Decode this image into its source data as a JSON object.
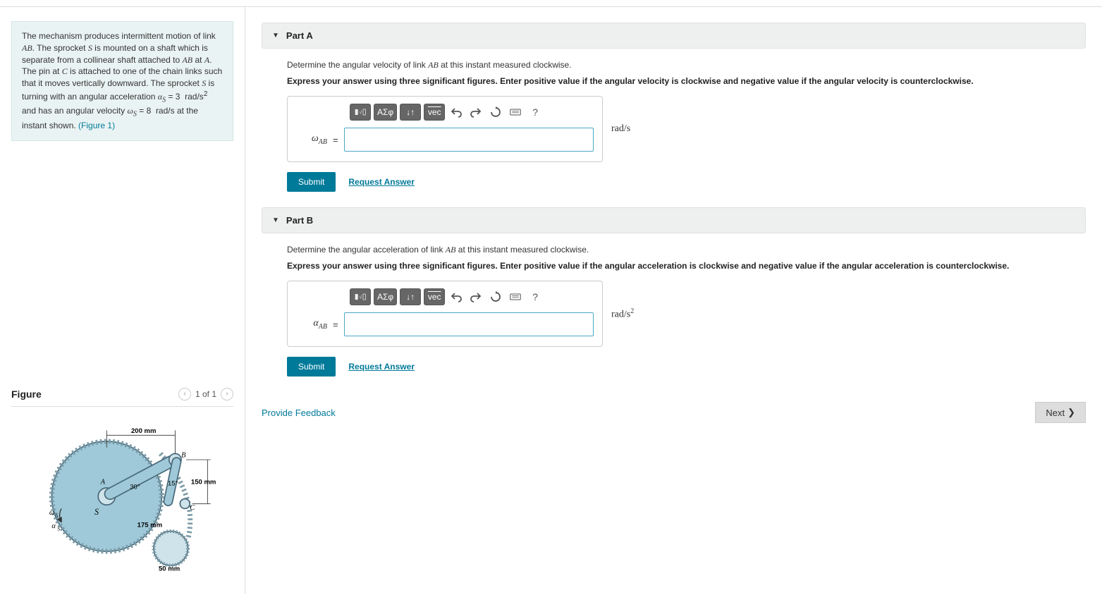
{
  "problem": {
    "text_html": "The mechanism produces intermittent motion of link <span class='mathit'>AB</span>. The sprocket <span class='mathit'>S</span> is mounted on a shaft which is separate from a collinear shaft attached to <span class='mathit'>AB</span> at <span class='mathit'>A</span>. The pin at <span class='mathit'>C</span> is attached to one of the chain links such that it moves vertically downward. The sprocket <span class='mathit'>S</span> is turning with an angular acceleration <span class='mathit'>α<sub>S</sub></span> = 3&nbsp; rad/s<sup>2</sup> and has an angular velocity <span class='mathit'>ω<sub>S</sub></span> = 8&nbsp; rad/s at the instant shown. ",
    "figure_link": "(Figure 1)"
  },
  "figure_panel": {
    "title": "Figure",
    "counter": "1 of 1",
    "dims": {
      "d1": "200 mm",
      "d2": "150 mm",
      "d3": "175 mm",
      "d4": "50 mm",
      "ang1": "30°",
      "ang2": "15°"
    },
    "labels": {
      "A": "A",
      "B": "B",
      "C": "C",
      "S": "S",
      "wS": "ωS",
      "aS": "αS"
    }
  },
  "parts": [
    {
      "title": "Part A",
      "question_html": "Determine the angular velocity of link <span class='mathit'>AB</span> at this instant measured clockwise.",
      "instruction": "Express your answer using three significant figures. Enter positive value if the angular velocity is clockwise and negative value if the angular velocity is counterclockwise.",
      "var_label_html": "ω<sub>AB</sub>",
      "unit_html": "rad/s",
      "value": "",
      "submit": "Submit",
      "request": "Request Answer"
    },
    {
      "title": "Part B",
      "question_html": "Determine the angular acceleration of link <span class='mathit'>AB</span> at this instant measured clockwise.",
      "instruction": "Express your answer using three significant figures. Enter positive value if the angular acceleration is clockwise and negative value if the angular acceleration is counterclockwise.",
      "var_label_html": "α<sub>AB</sub>",
      "unit_html": "rad/s<sup>2</sup>",
      "value": "",
      "submit": "Submit",
      "request": "Request Answer"
    }
  ],
  "toolbar": {
    "templates": "templates",
    "greek": "ΑΣφ",
    "subsup": "↓↑",
    "vec": "vec",
    "undo": "undo",
    "redo": "redo",
    "reset": "reset",
    "keyboard": "keyboard",
    "help": "?"
  },
  "bottom": {
    "feedback": "Provide Feedback",
    "next": "Next"
  }
}
